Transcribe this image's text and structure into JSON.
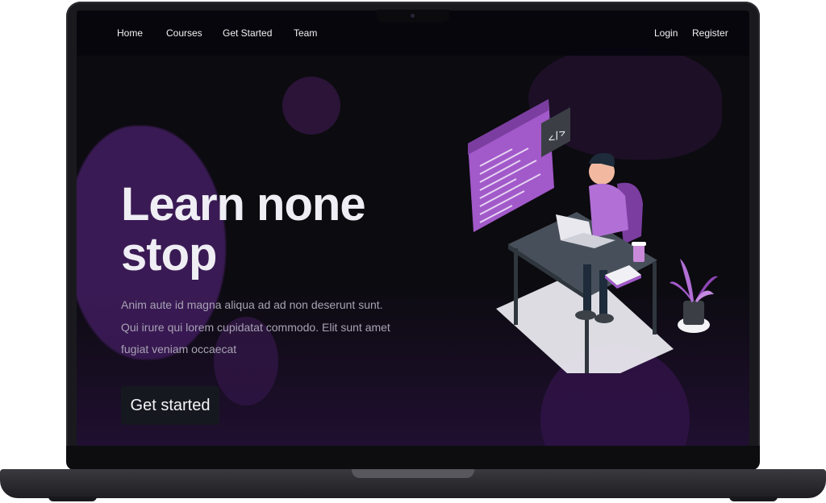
{
  "nav": {
    "left": [
      "Home",
      "Courses",
      "Get Started",
      "Team"
    ],
    "right": [
      "Login",
      "Register"
    ]
  },
  "hero": {
    "title_line1": "Learn none",
    "title_line2": "stop",
    "description": "Anim aute id magna aliqua ad ad non deserunt sunt. Qui irure qui lorem cupidatat commodo. Elit sunt amet fugiat veniam occaecat",
    "cta_label": "Get started"
  },
  "illustration": {
    "code_badge": "</>"
  },
  "colors": {
    "accent": "#a259c9",
    "screen_bg": "#0c0b10",
    "button_bg": "#161820"
  }
}
